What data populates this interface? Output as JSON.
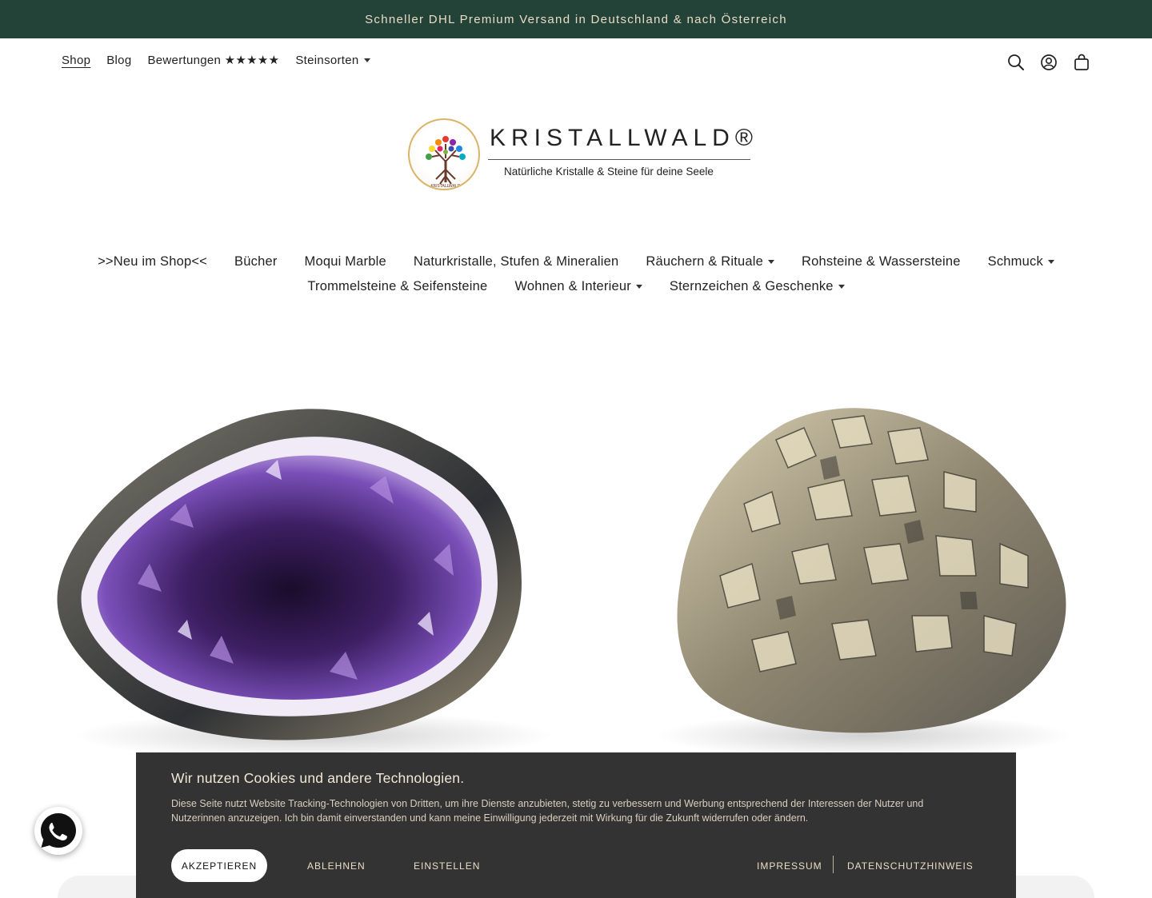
{
  "topbar": {
    "text": "Schneller DHL Premium Versand in Deutschland & nach Österreich"
  },
  "utilnav": {
    "items": [
      {
        "label": "Shop"
      },
      {
        "label": "Blog"
      },
      {
        "label": "Bewertungen ★★★★★"
      },
      {
        "label": "Steinsorten"
      }
    ]
  },
  "header_icons": [
    "search-icon",
    "account-icon",
    "cart-icon"
  ],
  "logo": {
    "brand": "KRISTALLWALD®",
    "tagline": "Natürliche Kristalle & Steine für deine Seele",
    "seal_text": "KRISTALLWALD"
  },
  "mainnav": {
    "row1": [
      {
        "label": ">>Neu im Shop<<"
      },
      {
        "label": "Bücher"
      },
      {
        "label": "Moqui Marble"
      },
      {
        "label": "Naturkristalle, Stufen & Mineralien"
      },
      {
        "label": "Räuchern & Rituale"
      },
      {
        "label": "Rohsteine & Wassersteine"
      },
      {
        "label": "Schmuck"
      }
    ],
    "row2": [
      {
        "label": "Trommelsteine & Seifensteine"
      },
      {
        "label": "Wohnen & Interieur"
      },
      {
        "label": "Sternzeichen & Geschenke"
      }
    ]
  },
  "cookie": {
    "title": "Wir nutzen Cookies und andere Technologien.",
    "body": "Diese Seite nutzt Website Tracking-Technologien von Dritten, um ihre Dienste anzubieten, stetig zu verbessern und Werbung entsprechend der Interessen der Nutzer und Nutzerinnen anzuzeigen. Ich bin damit einverstanden und kann meine Einwilligung jederzeit mit Wirkung für die Zukunft widerrufen oder ändern.",
    "accept": "AKZEPTIEREN",
    "decline": "ABLEHNEN",
    "settings": "EINSTELLEN",
    "imprint": "IMPRESSUM",
    "privacy": "DATENSCHUTZHINWEIS"
  },
  "colors": {
    "topbar_bg": "#234238",
    "topbar_text": "#e9dcc6",
    "cookie_bg": "#333333",
    "amethyst": "#6b3fa0",
    "pyrite": "#b8ab8a"
  }
}
